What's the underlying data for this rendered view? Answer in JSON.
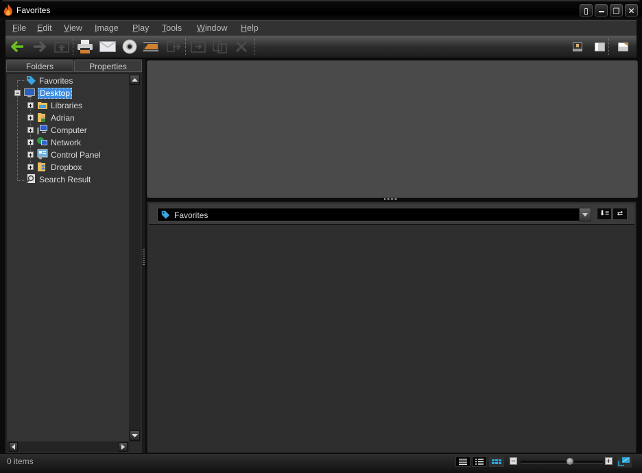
{
  "window": {
    "title": "Favorites",
    "controls": [
      "pin-icon",
      "minimize-icon",
      "restore-icon",
      "close-icon"
    ]
  },
  "menu": [
    {
      "label": "File",
      "accel": "F",
      "rest": "ile"
    },
    {
      "label": "Edit",
      "accel": "E",
      "rest": "dit"
    },
    {
      "label": "View",
      "accel": "V",
      "rest": "iew"
    },
    {
      "label": "Image",
      "accel": "I",
      "rest": "mage"
    },
    {
      "label": "Play",
      "accel": "P",
      "rest": "lay"
    },
    {
      "label": "Tools",
      "accel": "T",
      "rest": "ools"
    },
    {
      "label": "Window",
      "accel": "W",
      "rest": "indow"
    },
    {
      "label": "Help",
      "accel": "H",
      "rest": "elp"
    }
  ],
  "toolbar": {
    "left": [
      "back-arrow-icon",
      "forward-arrow-icon",
      "up-folder-icon",
      "print-icon",
      "email-icon",
      "burn-disc-icon",
      "slideshow-icon",
      "move-to-icon",
      "copy-to-folder-icon",
      "duplicate-icon",
      "delete-icon"
    ],
    "right": [
      "preview-pane-icon",
      "layout-pane-icon",
      "full-screen-icon"
    ]
  },
  "left_panel": {
    "tabs": [
      {
        "label": "Folders",
        "active": true
      },
      {
        "label": "Properties",
        "active": false
      }
    ],
    "tree": [
      {
        "label": "Favorites",
        "icon": "tag-icon",
        "level": 0,
        "expander": null
      },
      {
        "label": "Desktop",
        "icon": "desktop-icon",
        "level": 0,
        "expander": "-",
        "selected": true
      },
      {
        "label": "Libraries",
        "icon": "libraries-icon",
        "level": 1,
        "expander": "+"
      },
      {
        "label": "Adrian",
        "icon": "user-folder-icon",
        "level": 1,
        "expander": "+"
      },
      {
        "label": "Computer",
        "icon": "computer-icon",
        "level": 1,
        "expander": "+"
      },
      {
        "label": "Network",
        "icon": "network-icon",
        "level": 1,
        "expander": "+"
      },
      {
        "label": "Control Panel",
        "icon": "control-panel-icon",
        "level": 1,
        "expander": "+"
      },
      {
        "label": "Dropbox",
        "icon": "dropbox-icon",
        "level": 1,
        "expander": "+"
      },
      {
        "label": "Search Result",
        "icon": "search-result-icon",
        "level": 0,
        "expander": null
      }
    ]
  },
  "address_bar": {
    "value": "Favorites",
    "buttons": [
      "sort-icon",
      "column-resize-icon"
    ]
  },
  "status": {
    "items_text": "0 items",
    "view_modes": [
      "details-view",
      "list-view",
      "thumbnail-view"
    ],
    "active_view": "thumbnail-view",
    "zoom_level_fraction": 0.6
  },
  "colors": {
    "accent": "#2a9fd6",
    "selection": "#3d8ee0",
    "back_arrow": "#6abf1f"
  }
}
